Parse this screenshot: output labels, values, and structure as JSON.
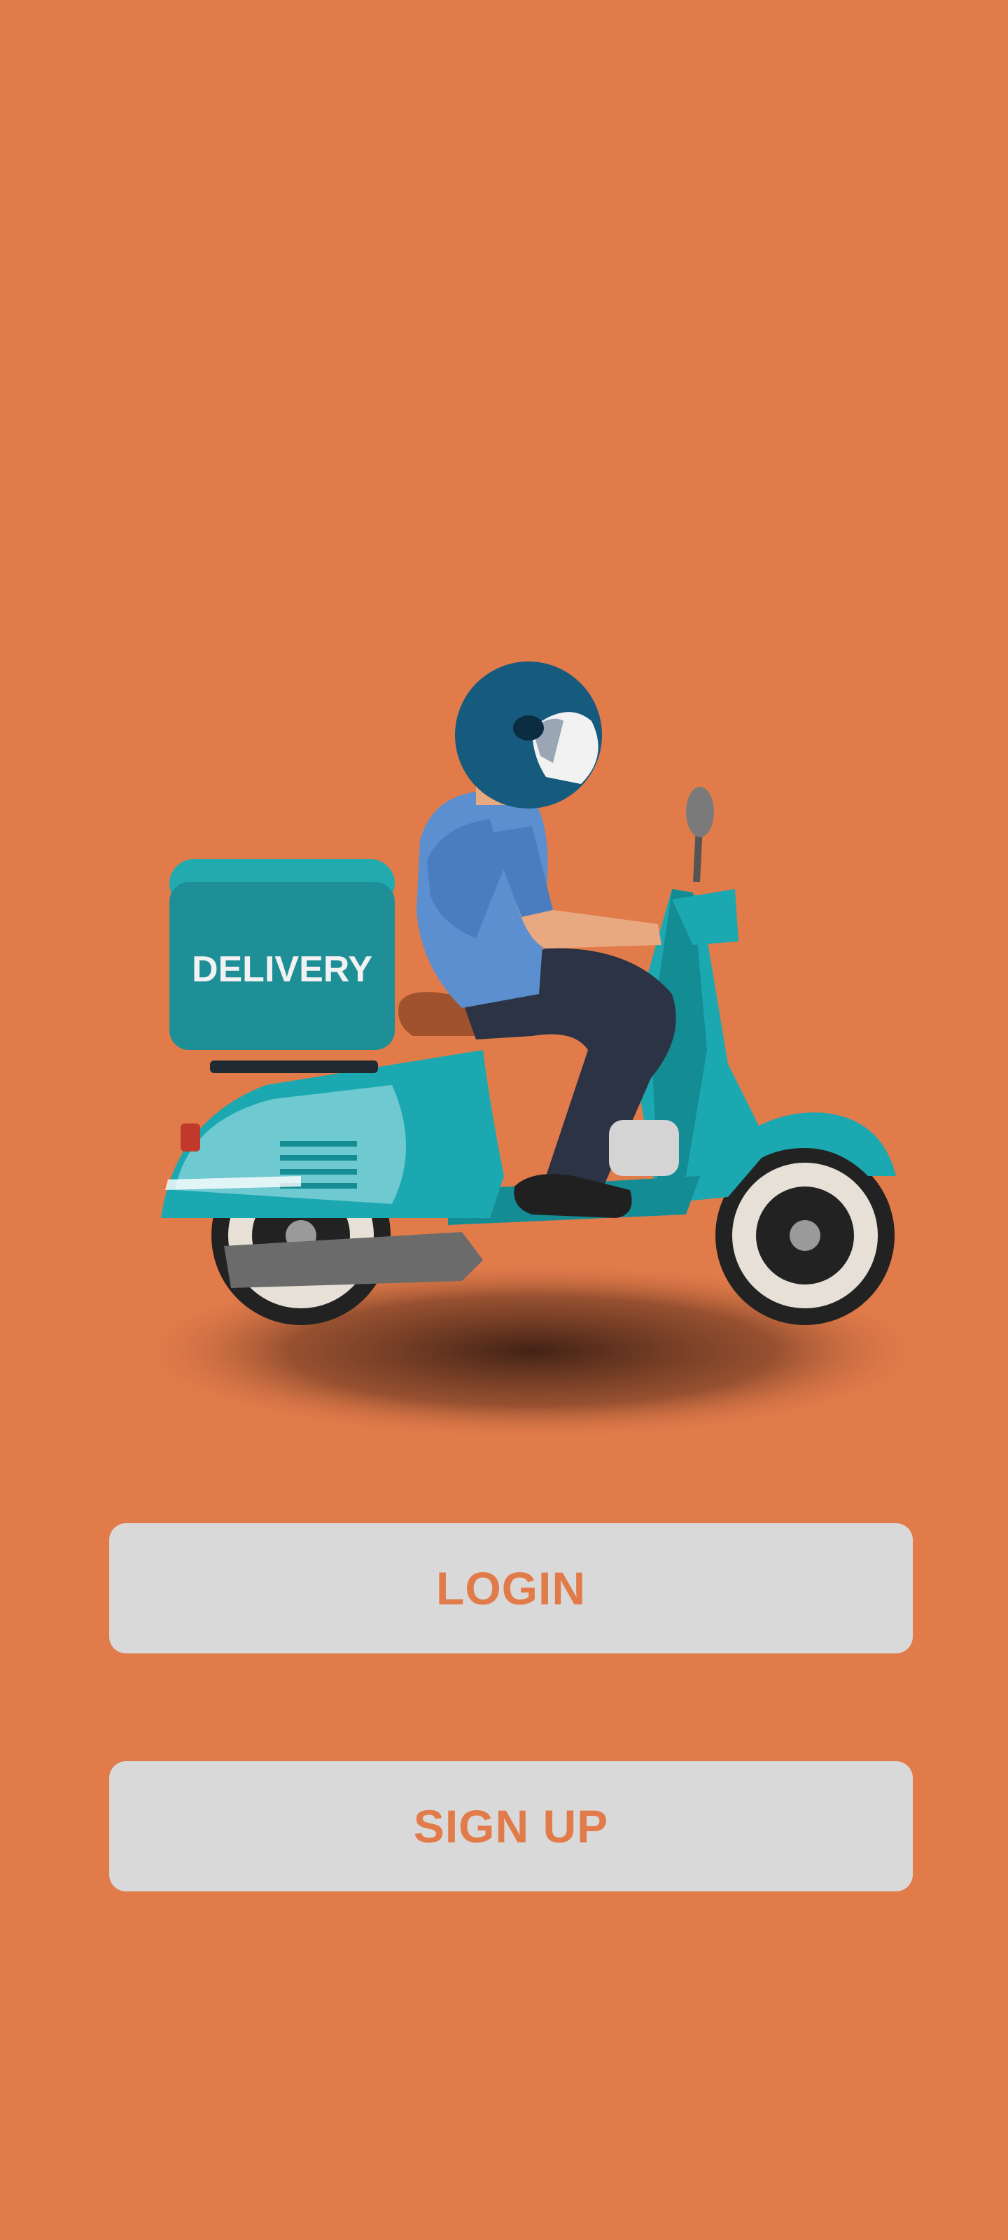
{
  "colors": {
    "background": "#E27B4A",
    "button_bg": "#D9D9D9",
    "button_text": "#E27B4A"
  },
  "hero": {
    "illustration": "delivery-scooter-rider",
    "box_label": "DELIVERY"
  },
  "actions": {
    "login_label": "LOGIN",
    "signup_label": "SIGN UP"
  }
}
